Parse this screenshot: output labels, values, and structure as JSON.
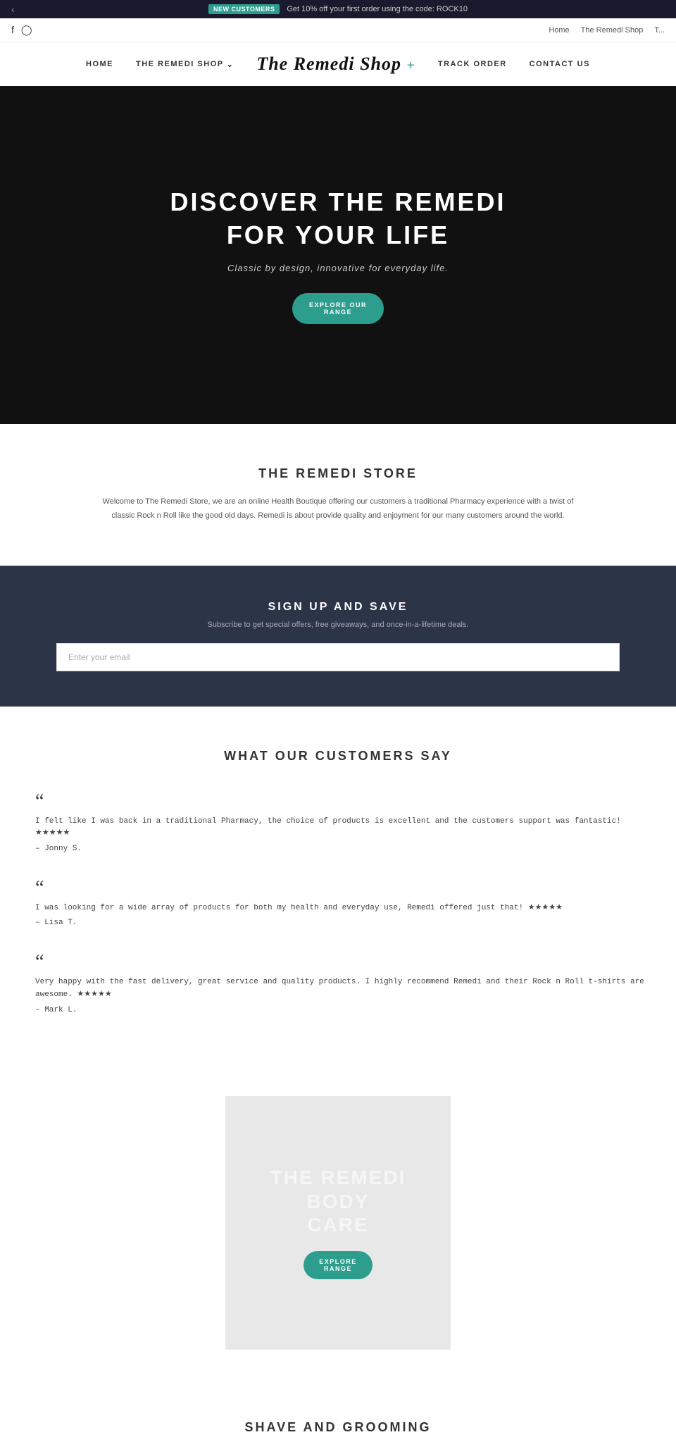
{
  "announcement": {
    "badge": "NEW CUSTOMERS",
    "message": "Get 10% off your first order using the code: ROCK10"
  },
  "secondary_nav": {
    "links": [
      "Home",
      "The Remedi Shop",
      "T..."
    ],
    "social": [
      "f",
      "instagram"
    ]
  },
  "main_nav": {
    "home": "HOME",
    "shop": "THE REMEDI SHOP",
    "track_order": "TRACK ORDER",
    "contact_us": "CONTACT US",
    "logo": "The Remedi Shop",
    "logo_plus": "+"
  },
  "hero": {
    "heading_line1": "DISCOVER THE REMEDI",
    "heading_line2": "FOR YOUR LIFE",
    "subtext": "Classic by design, innovative for everyday life.",
    "button": "EXPLORE OUR\nRANGE"
  },
  "store": {
    "heading": "THE REMEDI STORE",
    "body": "Welcome to The Remedi Store, we are an online Health Boutique offering our customers a traditional Pharmacy experience with a twist of classic Rock n Roll like the good old days. Remedi is about provide quality and enjoyment for our many customers around the world."
  },
  "signup": {
    "heading": "SIGN UP AND SAVE",
    "subtext": "Subscribe to get special offers, free giveaways, and once-in-a-lifetime deals.",
    "email_placeholder": "Enter your email"
  },
  "testimonials": {
    "heading": "WHAT OUR CUSTOMERS SAY",
    "items": [
      {
        "text": "I felt like I was back in a traditional Pharmacy, the choice of products is excellent and the customers support was fantastic! ★★★★★",
        "author": "– Jonny S.",
        "stars": "★★★★★"
      },
      {
        "text": "I was looking for a wide array of products for both my health and everyday use, Remedi offered just that! ★★★★★",
        "author": "– Lisa T.",
        "stars": "★★★★★"
      },
      {
        "text": "Very happy with the fast delivery, great service and quality products. I highly recommend Remedi and their Rock n Roll t-shirts are awesome. ★★★★★",
        "author": "– Mark L.",
        "stars": "★★★★★"
      }
    ]
  },
  "body_care": {
    "heading": "THE REMEDI BODY CARE",
    "button": "EXPLORE\nRANGE"
  },
  "shave": {
    "heading": "SHAVE AND GROOMING"
  }
}
